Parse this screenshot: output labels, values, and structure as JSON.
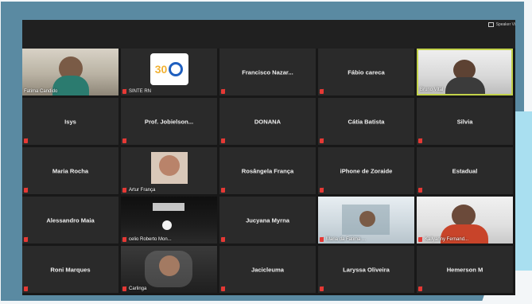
{
  "topbar": {
    "speaker_view_label": "Speaker Vi"
  },
  "tiles": [
    {
      "kind": "video",
      "caption": "Fatima Candido",
      "muted": false
    },
    {
      "kind": "logo",
      "caption": "SINTE RN",
      "muted": true,
      "logo_text": "30"
    },
    {
      "kind": "name",
      "label": "Francisco  Nazar...",
      "muted": true
    },
    {
      "kind": "name",
      "label": "Fábio careca",
      "muted": true
    },
    {
      "kind": "video",
      "caption": "Bruno Vital",
      "muted": false,
      "active": true
    },
    {
      "kind": "name",
      "label": "Isys",
      "muted": true
    },
    {
      "kind": "name",
      "label": "Prof. Jobielson...",
      "muted": true
    },
    {
      "kind": "name",
      "label": "DONANA",
      "muted": true
    },
    {
      "kind": "name",
      "label": "Cátia Batista",
      "muted": true
    },
    {
      "kind": "name",
      "label": "Silvia",
      "muted": true
    },
    {
      "kind": "name",
      "label": "Maria Rocha",
      "muted": true
    },
    {
      "kind": "video",
      "caption": "Artur França",
      "muted": true
    },
    {
      "kind": "name",
      "label": "Rosângela França",
      "muted": true
    },
    {
      "kind": "name",
      "label": "iPhone de Zoraide",
      "muted": true
    },
    {
      "kind": "name",
      "label": "Estadual",
      "muted": true
    },
    {
      "kind": "name",
      "label": "Alessandro Maia",
      "muted": true
    },
    {
      "kind": "video",
      "caption": "celio Roberto Mon...",
      "muted": true
    },
    {
      "kind": "name",
      "label": "Jucyana Myrna",
      "muted": true
    },
    {
      "kind": "video",
      "caption": "Maria da Fatima ...",
      "muted": true
    },
    {
      "kind": "video",
      "caption": "Kallyanny Fernand...",
      "muted": true
    },
    {
      "kind": "name",
      "label": "Roni Marques",
      "muted": true
    },
    {
      "kind": "video",
      "caption": "Carlinga",
      "muted": true
    },
    {
      "kind": "name",
      "label": "Jacicleuma",
      "muted": true
    },
    {
      "kind": "name",
      "label": "Laryssa Oliveira",
      "muted": true
    },
    {
      "kind": "name",
      "label": "Hemerson  M",
      "muted": true
    }
  ]
}
